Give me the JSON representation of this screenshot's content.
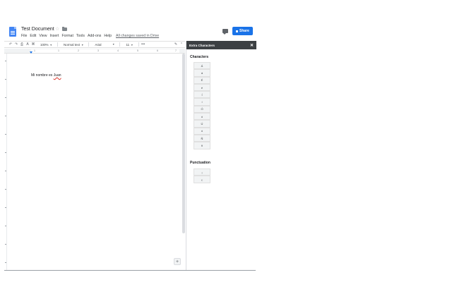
{
  "header": {
    "title": "Test Document",
    "menu": [
      "File",
      "Edit",
      "View",
      "Insert",
      "Format",
      "Tools",
      "Add-ons",
      "Help"
    ],
    "save_status": "All changes saved in Drive",
    "share_label": "Share"
  },
  "toolbar": {
    "zoom": "100%",
    "style": "Normal text",
    "font": "Arial",
    "size": "11",
    "more": "•••"
  },
  "ruler": {
    "marks": [
      "1",
      "1",
      "2",
      "3",
      "4",
      "5",
      "6",
      "7"
    ]
  },
  "document": {
    "text_prefix": "Mi nombre es ",
    "text_name": "Juan"
  },
  "panel": {
    "title": "Extra Characters",
    "characters_heading": "Characters",
    "characters": [
      "Á",
      "á",
      "É",
      "é",
      "Í",
      "í",
      "Ó",
      "ó",
      "Ú",
      "ú",
      "Ñ",
      "ñ"
    ],
    "punctuation_heading": "Punctuation",
    "punctuation": [
      "¡",
      "¿"
    ]
  }
}
